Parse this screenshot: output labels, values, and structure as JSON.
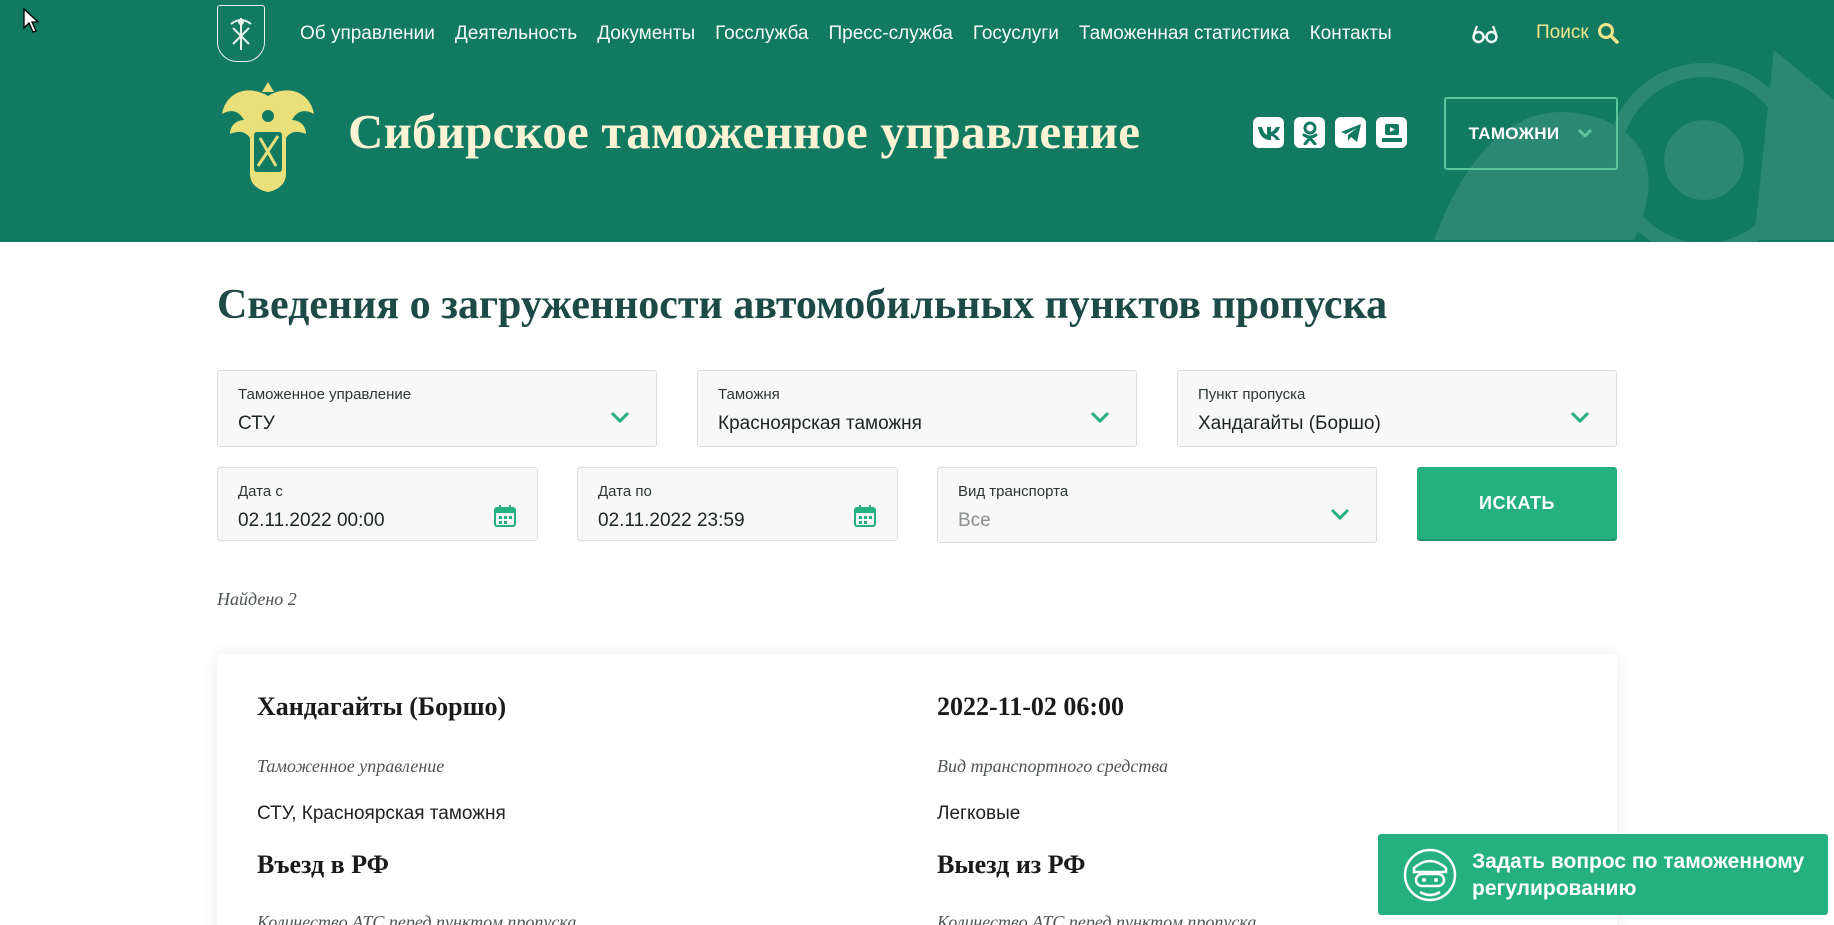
{
  "colors": {
    "header_bg": "#137a62",
    "accent": "#24b07f",
    "title_text": "#1c4a46"
  },
  "nav": {
    "items": [
      "Об управлении",
      "Деятельность",
      "Документы",
      "Госслужба",
      "Пресс-служба",
      "Госуслуги",
      "Таможенная статистика",
      "Контакты"
    ],
    "search_label": "Поиск",
    "vision_icon": "glasses-icon",
    "search_icon": "search-icon"
  },
  "header": {
    "site_title": "Сибирское таможенное управление",
    "socials": [
      "vk-icon",
      "odnoklassniki-icon",
      "telegram-icon",
      "rutube-icon"
    ],
    "customs_button": "ТАМОЖНИ"
  },
  "main": {
    "page_title": "Сведения о загруженности автомобильных пунктов пропуска",
    "filters": {
      "customs_office": {
        "label": "Таможенное управление",
        "value": "СТУ"
      },
      "customs": {
        "label": "Таможня",
        "value": "Красноярская таможня"
      },
      "checkpoint": {
        "label": "Пункт пропуска",
        "value": "Хандагайты (Боршо)"
      },
      "date_from": {
        "label": "Дата с",
        "value": "02.11.2022 00:00"
      },
      "date_to": {
        "label": "Дата по",
        "value": "02.11.2022 23:59"
      },
      "transport": {
        "label": "Вид транспорта",
        "value": "Все"
      },
      "search_button": "ИСКАТЬ"
    },
    "found_text": "Найдено 2",
    "result": {
      "checkpoint_name": "Хандагайты (Боршо)",
      "datetime": "2022-11-02 06:00",
      "customs_label": "Таможенное управление",
      "customs_value": "СТУ, Красноярская таможня",
      "vehicle_label": "Вид транспортного средства",
      "vehicle_value": "Легковые",
      "entry_heading": "Въезд в РФ",
      "exit_heading": "Выезд из РФ",
      "queue_label_entry": "Количество АТС перед пунктом пропуска",
      "queue_label_exit": "Количество АТС перед пунктом пропуска"
    }
  },
  "ask_button": "Задать вопрос по таможенному регулированию"
}
